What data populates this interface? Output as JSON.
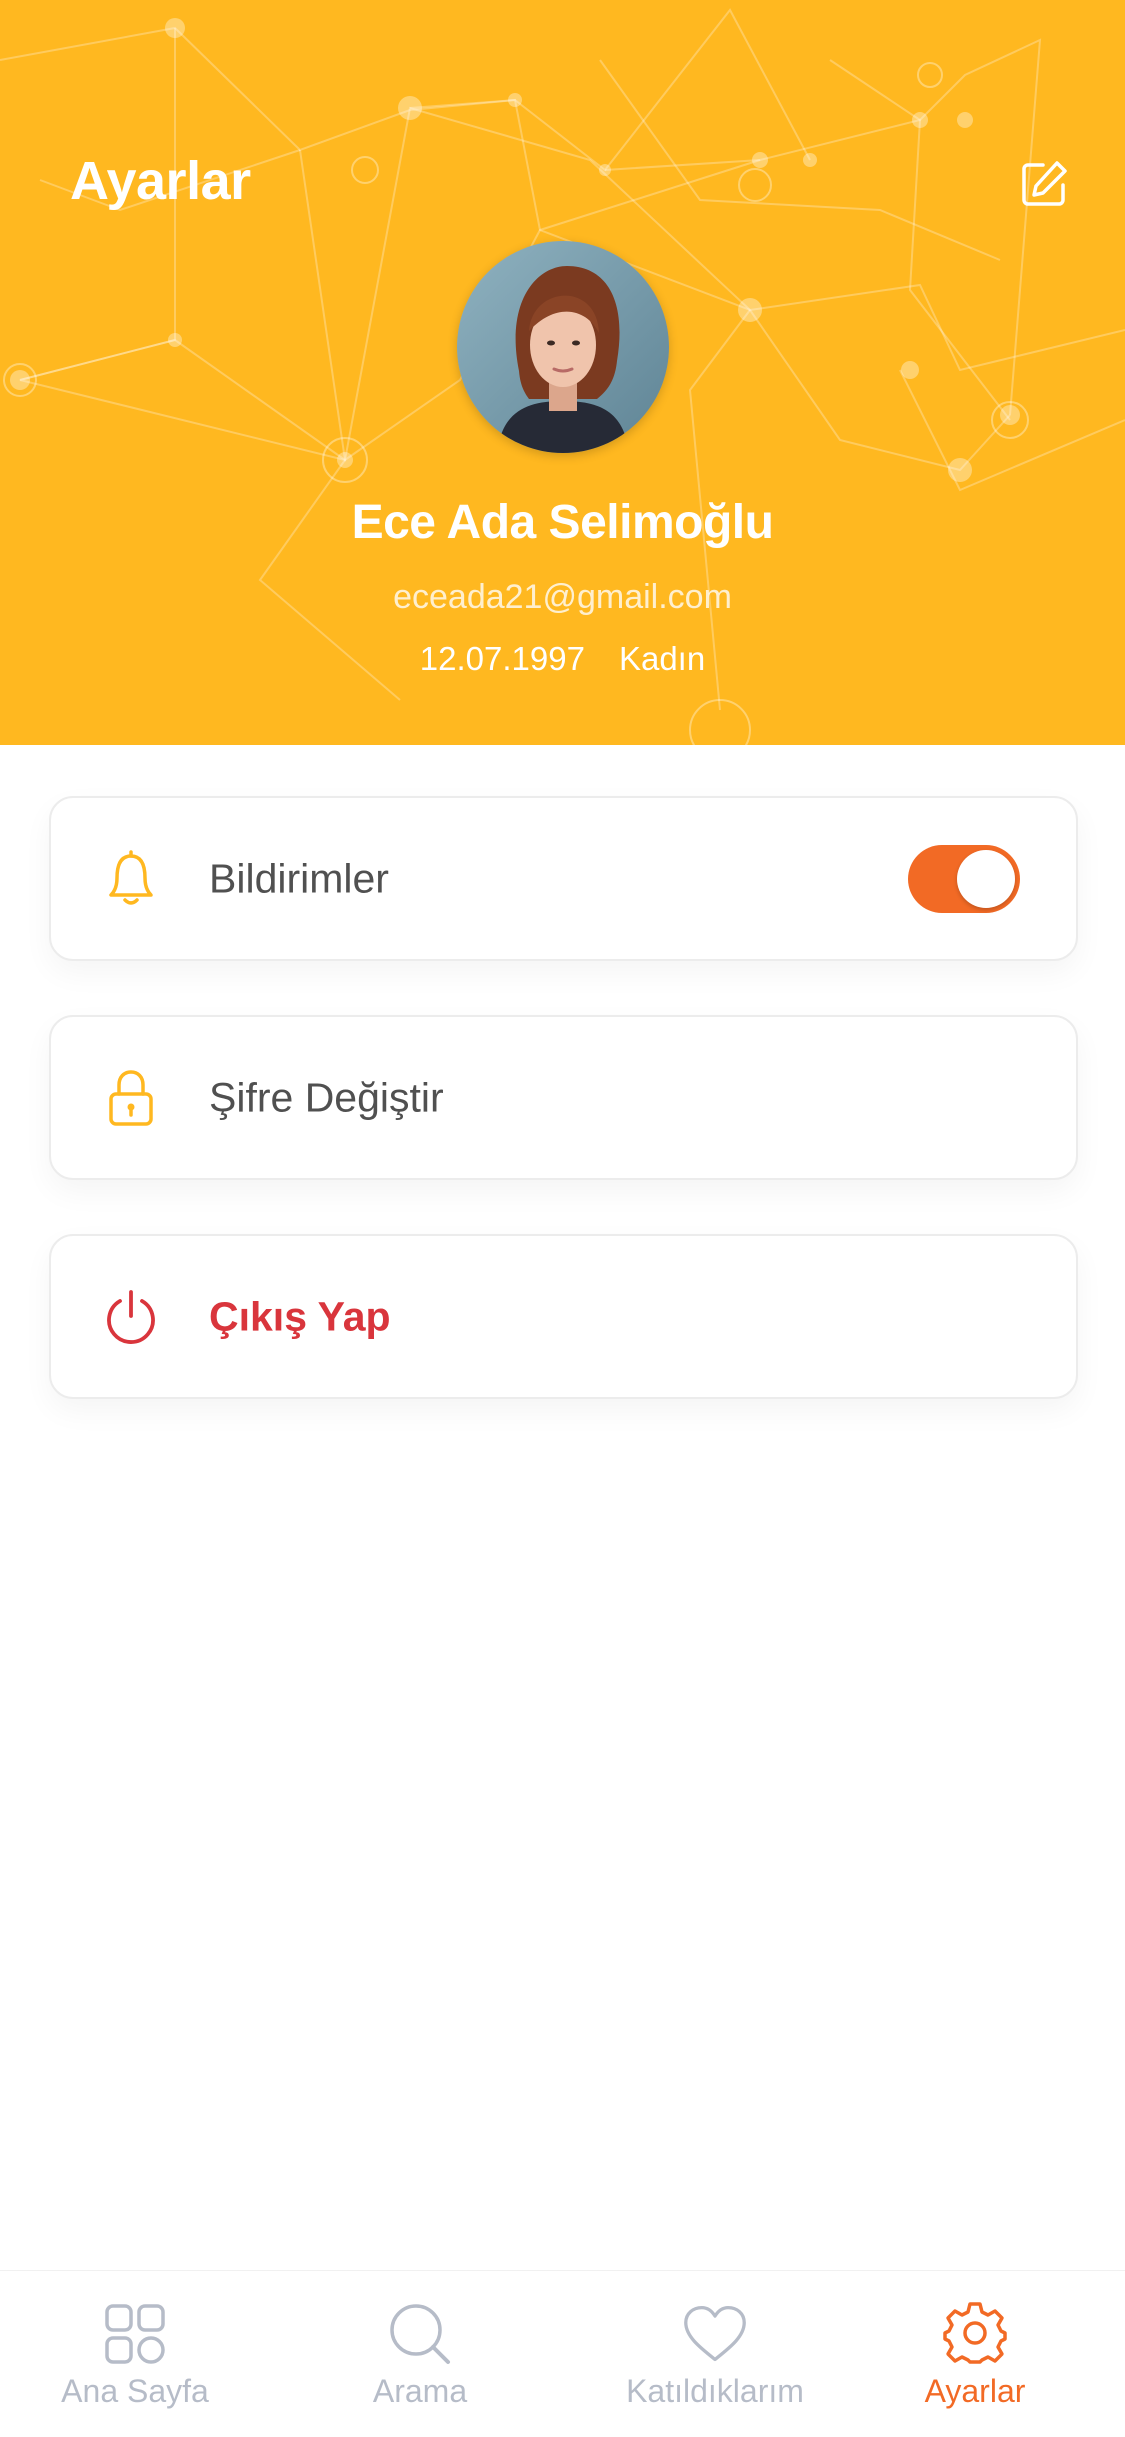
{
  "header": {
    "title": "Ayarlar",
    "edit_icon": "edit-icon",
    "background_color": "#FFB820"
  },
  "profile": {
    "avatar": "avatar-photo",
    "name": "Ece Ada Selimoğlu",
    "email": "eceada21@gmail.com",
    "birth_date": "12.07.1997",
    "gender": "Kadın"
  },
  "settings": {
    "notifications": {
      "icon": "bell-icon",
      "label": "Bildirimler",
      "enabled": true
    },
    "change_password": {
      "icon": "lock-icon",
      "label": "Şifre Değiştir"
    },
    "logout": {
      "icon": "power-icon",
      "label": "Çıkış Yap"
    }
  },
  "tabbar": {
    "items": [
      {
        "icon": "grid-icon",
        "label": "Ana Sayfa",
        "active": false
      },
      {
        "icon": "search-icon",
        "label": "Arama",
        "active": false
      },
      {
        "icon": "heart-icon",
        "label": "Katıldıklarım",
        "active": false
      },
      {
        "icon": "gear-icon",
        "label": "Ayarlar",
        "active": true
      }
    ]
  },
  "colors": {
    "accent": "#F26A25",
    "header": "#FFB820",
    "danger": "#D9353C",
    "icon_yellow": "#FFB820",
    "inactive_tab": "#B6BCC8"
  }
}
